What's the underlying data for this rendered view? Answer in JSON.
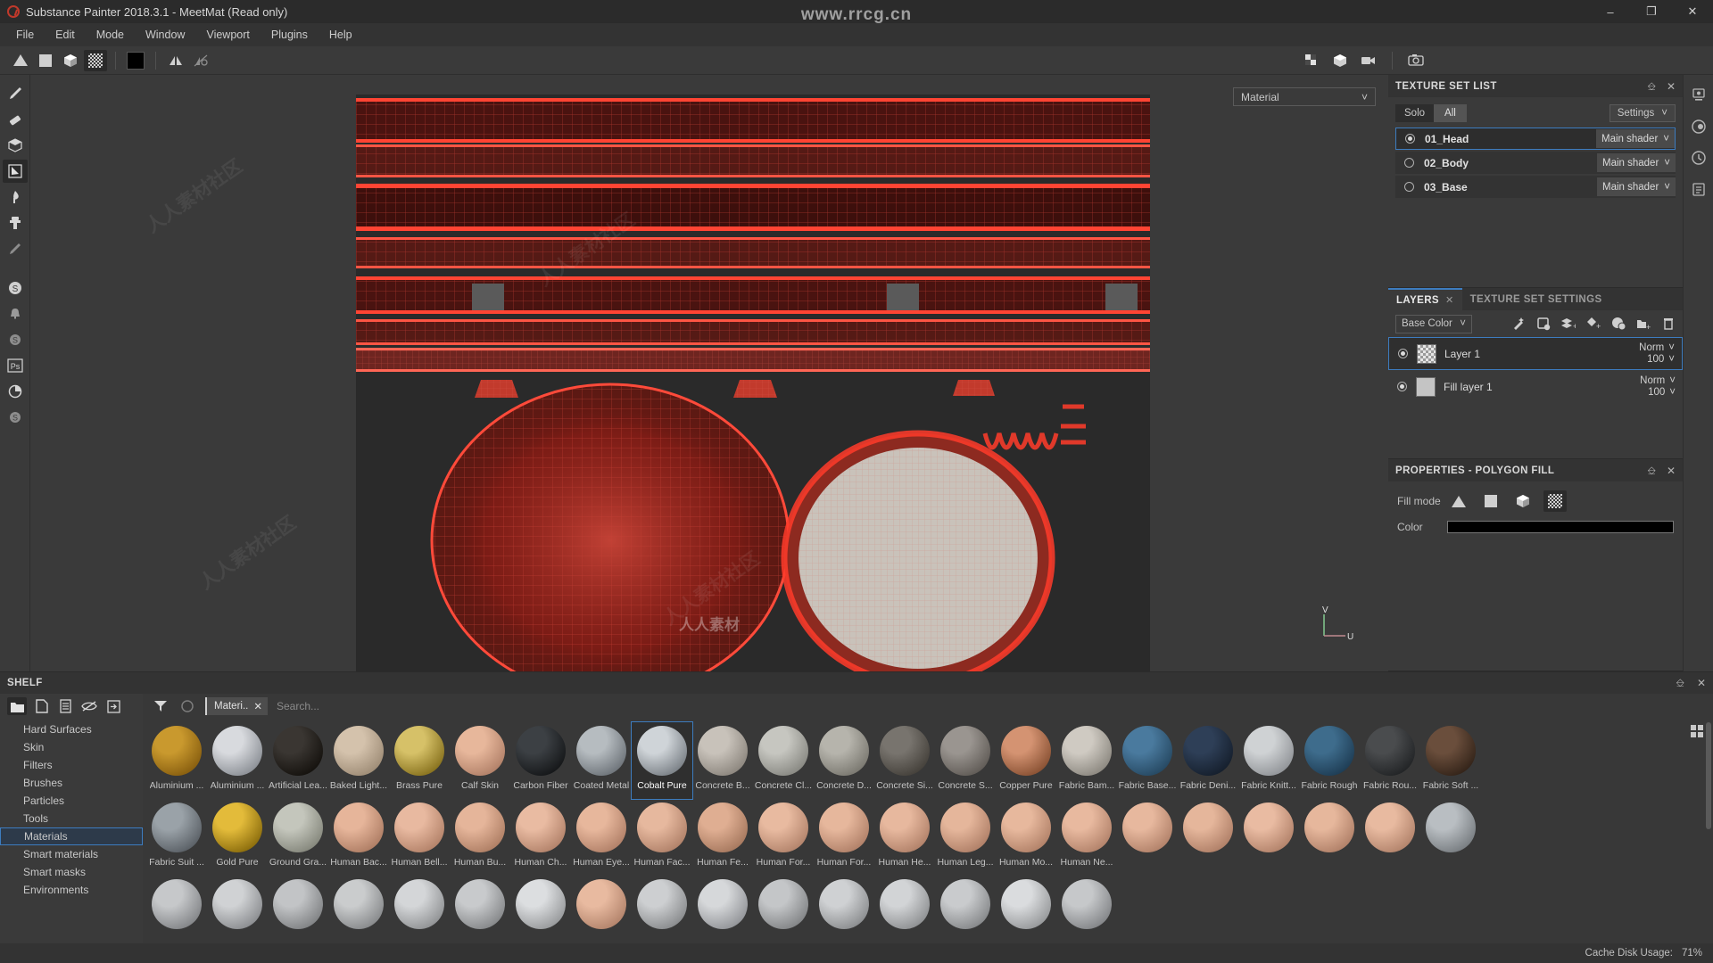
{
  "window": {
    "title": "Substance Painter 2018.3.1 - MeetMat (Read only)",
    "minimize": "–",
    "maximize": "❐",
    "close": "✕"
  },
  "watermark": {
    "top": "www.rrcg.cn",
    "diag": "人人素材社区",
    "bottom": "人人素材"
  },
  "menu": {
    "items": [
      "File",
      "Edit",
      "Mode",
      "Window",
      "Viewport",
      "Plugins",
      "Help"
    ]
  },
  "toolbar": {
    "left_tools": [
      "triangle-fill-icon",
      "square-fill-icon",
      "cube-fill-icon",
      "checker-fill-icon"
    ],
    "color_swatch": "#000000",
    "symmetry_label": "symmetry-icon",
    "symmetry_disabled_label": "symmetry-disabled-icon",
    "right_tools": [
      "checker-view-icon",
      "cube-view-icon",
      "camera-video-icon",
      "photo-camera-icon"
    ]
  },
  "left_rail": {
    "items": [
      {
        "name": "paint-brush-tool",
        "active": false
      },
      {
        "name": "eraser-tool",
        "active": false
      },
      {
        "name": "projection-tool",
        "active": false
      },
      {
        "name": "polygon-fill-tool",
        "active": true
      },
      {
        "name": "smudge-tool",
        "active": false
      },
      {
        "name": "clone-stamp-tool",
        "active": false
      },
      {
        "name": "material-picker-tool",
        "active": false
      },
      {
        "name": "substance-source-icon",
        "active": false
      },
      {
        "name": "alert-bell-icon",
        "active": false
      },
      {
        "name": "substance-share-icon",
        "active": false
      },
      {
        "name": "photoshop-icon",
        "active": false
      },
      {
        "name": "bake-mesh-maps-icon",
        "active": false
      },
      {
        "name": "substance-engine-icon",
        "active": false
      }
    ]
  },
  "viewport": {
    "material_dropdown": "Material",
    "uv_axis_v": "V",
    "uv_axis_u": "U"
  },
  "texture_set_list": {
    "title": "TEXTURE SET LIST",
    "solo_label": "Solo",
    "all_label": "All",
    "settings_label": "Settings",
    "rows": [
      {
        "name": "01_Head",
        "shader": "Main shader",
        "selected": true,
        "visible": true
      },
      {
        "name": "02_Body",
        "shader": "Main shader",
        "selected": false,
        "visible": false
      },
      {
        "name": "03_Base",
        "shader": "Main shader",
        "selected": false,
        "visible": false
      }
    ]
  },
  "layers_panel": {
    "tab_layers": "LAYERS",
    "tab_texture_set_settings": "TEXTURE SET SETTINGS",
    "channel": "Base Color",
    "tools": [
      "add-effect-icon",
      "add-mask-icon",
      "add-fill-layer-icon",
      "add-paint-layer-icon",
      "add-smart-material-icon",
      "add-folder-icon",
      "delete-layer-icon"
    ],
    "layers": [
      {
        "name": "Layer 1",
        "blend": "Norm",
        "opacity": "100",
        "selected": true,
        "thumb": "checker"
      },
      {
        "name": "Fill layer 1",
        "blend": "Norm",
        "opacity": "100",
        "selected": false,
        "thumb": "solid"
      }
    ]
  },
  "properties_panel": {
    "title": "PROPERTIES - POLYGON FILL",
    "fill_mode_label": "Fill mode",
    "fill_modes": [
      "triangle-fill-icon",
      "square-fill-icon",
      "cube-fill-icon",
      "checker-fill-icon"
    ],
    "active_fill_mode": 3,
    "color_label": "Color",
    "color_value": "#000000"
  },
  "right_rail": {
    "items": [
      "display-settings-icon",
      "shader-settings-icon",
      "history-icon",
      "log-icon"
    ]
  },
  "shelf": {
    "title": "SHELF",
    "tools": [
      "folder-icon",
      "new-document-icon",
      "list-view-icon",
      "hide-icon",
      "import-icon"
    ],
    "filter_icon": "filter-funnel-icon",
    "reset_icon": "reset-circle-icon",
    "chip_label": "Materi..",
    "chip_close": "✕",
    "search_placeholder": "Search...",
    "categories": [
      {
        "label": "Hard Surfaces",
        "selected": false
      },
      {
        "label": "Skin",
        "selected": false
      },
      {
        "label": "Filters",
        "selected": false
      },
      {
        "label": "Brushes",
        "selected": false
      },
      {
        "label": "Particles",
        "selected": false
      },
      {
        "label": "Tools",
        "selected": false
      },
      {
        "label": "Materials",
        "selected": true
      },
      {
        "label": "Smart materials",
        "selected": false
      },
      {
        "label": "Smart masks",
        "selected": false
      },
      {
        "label": "Environments",
        "selected": false
      }
    ],
    "items": [
      {
        "label": "Aluminium ...",
        "color": "#c9992e",
        "color2": "#8a6010",
        "selected": false
      },
      {
        "label": "Aluminium ...",
        "color": "#d8dade",
        "color2": "#8e9298",
        "selected": false
      },
      {
        "label": "Artificial Lea...",
        "color": "#3a3632",
        "color2": "#16130f",
        "selected": false
      },
      {
        "label": "Baked Light...",
        "color": "#d4c2ac",
        "color2": "#a08e78",
        "selected": false
      },
      {
        "label": "Brass Pure",
        "color": "#d6c168",
        "color2": "#8a7420",
        "selected": false
      },
      {
        "label": "Calf Skin",
        "color": "#e7b79b",
        "color2": "#b3826a",
        "selected": false
      },
      {
        "label": "Carbon Fiber",
        "color": "#3c4044",
        "color2": "#16181a",
        "selected": false
      },
      {
        "label": "Coated Metal",
        "color": "#b6bcc0",
        "color2": "#70767c",
        "selected": false
      },
      {
        "label": "Cobalt Pure",
        "color": "#cfd4d8",
        "color2": "#7d8389",
        "selected": true
      },
      {
        "label": "Concrete B...",
        "color": "#c8c2ba",
        "color2": "#8e8880",
        "selected": false
      },
      {
        "label": "Concrete Cl...",
        "color": "#c6c6c0",
        "color2": "#8a8a84",
        "selected": false
      },
      {
        "label": "Concrete D...",
        "color": "#b6b4ac",
        "color2": "#7c7a72",
        "selected": false
      },
      {
        "label": "Concrete Si...",
        "color": "#78746e",
        "color2": "#46423c",
        "selected": false
      },
      {
        "label": "Concrete S...",
        "color": "#9a9590",
        "color2": "#625d58",
        "selected": false
      },
      {
        "label": "Copper Pure",
        "color": "#d49372",
        "color2": "#8b5335",
        "selected": false
      },
      {
        "label": "Fabric Bam...",
        "color": "#cfcac2",
        "color2": "#8e8a82",
        "selected": false
      },
      {
        "label": "Fabric Base...",
        "color": "#4a7a9e",
        "color2": "#274a64",
        "selected": false
      },
      {
        "label": "Fabric Deni...",
        "color": "#2e3f57",
        "color2": "#16202e",
        "selected": false
      },
      {
        "label": "Fabric Knitt...",
        "color": "#cfd2d4",
        "color2": "#93969a",
        "selected": false
      },
      {
        "label": "Fabric Rough",
        "color": "#3e6c8c",
        "color2": "#1f3e56",
        "selected": false
      },
      {
        "label": "Fabric Rou...",
        "color": "#4a4c4e",
        "color2": "#232527",
        "selected": false
      },
      {
        "label": "Fabric Soft ...",
        "color": "#6a4e3c",
        "color2": "#35251a",
        "selected": false
      },
      {
        "label": "Fabric Suit ...",
        "color": "#9aa2a8",
        "color2": "#5c6268",
        "selected": false
      },
      {
        "label": "Gold Pure",
        "color": "#e3bb3a",
        "color2": "#8e6f0e",
        "selected": false
      },
      {
        "label": "Ground Gra...",
        "color": "#c4c6bc",
        "color2": "#87897e",
        "selected": false
      },
      {
        "label": "Human Bac...",
        "color": "#e6b59a",
        "color2": "#b07f66",
        "selected": false
      },
      {
        "label": "Human Bell...",
        "color": "#e8b9a0",
        "color2": "#b5846b",
        "selected": false
      },
      {
        "label": "Human Bu...",
        "color": "#e5b59a",
        "color2": "#b08066",
        "selected": false
      },
      {
        "label": "Human Ch...",
        "color": "#e9bba2",
        "color2": "#b4846c",
        "selected": false
      },
      {
        "label": "Human Eye...",
        "color": "#e7b79c",
        "color2": "#b3826a",
        "selected": false
      },
      {
        "label": "Human Fac...",
        "color": "#e6b89e",
        "color2": "#b2836b",
        "selected": false
      },
      {
        "label": "Human Fe...",
        "color": "#dfae92",
        "color2": "#a87a60",
        "selected": false
      },
      {
        "label": "Human For...",
        "color": "#e8baa0",
        "color2": "#b4856d",
        "selected": false
      },
      {
        "label": "Human For...",
        "color": "#e6b79c",
        "color2": "#b2826a",
        "selected": false
      },
      {
        "label": "Human He...",
        "color": "#e7b89e",
        "color2": "#b3836b",
        "selected": false
      },
      {
        "label": "Human Leg...",
        "color": "#e5b69b",
        "color2": "#b18169",
        "selected": false
      },
      {
        "label": "Human Mo...",
        "color": "#e7b89d",
        "color2": "#b3836a",
        "selected": false
      },
      {
        "label": "Human Ne...",
        "color": "#e8b99f",
        "color2": "#b4846c",
        "selected": false
      }
    ],
    "row3": [
      {
        "color": "#e7b89e",
        "color2": "#b3836b"
      },
      {
        "color": "#e5b69b",
        "color2": "#b18169"
      },
      {
        "color": "#e9bba2",
        "color2": "#b4846c"
      },
      {
        "color": "#e6b79c",
        "color2": "#b2826a"
      },
      {
        "color": "#e8baa0",
        "color2": "#b4856d"
      },
      {
        "color": "#b9bec2",
        "color2": "#7a7f83"
      },
      {
        "color": "#c6c8ca",
        "color2": "#85878a"
      },
      {
        "color": "#d0d2d4",
        "color2": "#8d8f92"
      },
      {
        "color": "#c2c4c6",
        "color2": "#828486"
      },
      {
        "color": "#cacccd",
        "color2": "#898b8d"
      },
      {
        "color": "#d4d6d8",
        "color2": "#929496"
      },
      {
        "color": "#c8cacc",
        "color2": "#87898b"
      },
      {
        "color": "#dcdee0",
        "color2": "#999b9d"
      },
      {
        "color": "#e8baa0",
        "color2": "#b4856d"
      },
      {
        "color": "#cdcfd1",
        "color2": "#8b8d8f"
      },
      {
        "color": "#d6d8da",
        "color2": "#94969a"
      },
      {
        "color": "#c4c6c8",
        "color2": "#848688"
      },
      {
        "color": "#cfd1d3",
        "color2": "#8d8f91"
      },
      {
        "color": "#d2d4d6",
        "color2": "#909294"
      },
      {
        "color": "#c9cbcd",
        "color2": "#888a8c"
      },
      {
        "color": "#dadcde",
        "color2": "#989a9c"
      },
      {
        "color": "#c6c8ca",
        "color2": "#85878a"
      }
    ],
    "grid_view_icon": "grid-view-icon"
  },
  "statusbar": {
    "cache_label": "Cache Disk Usage:",
    "cache_value": "71%"
  }
}
